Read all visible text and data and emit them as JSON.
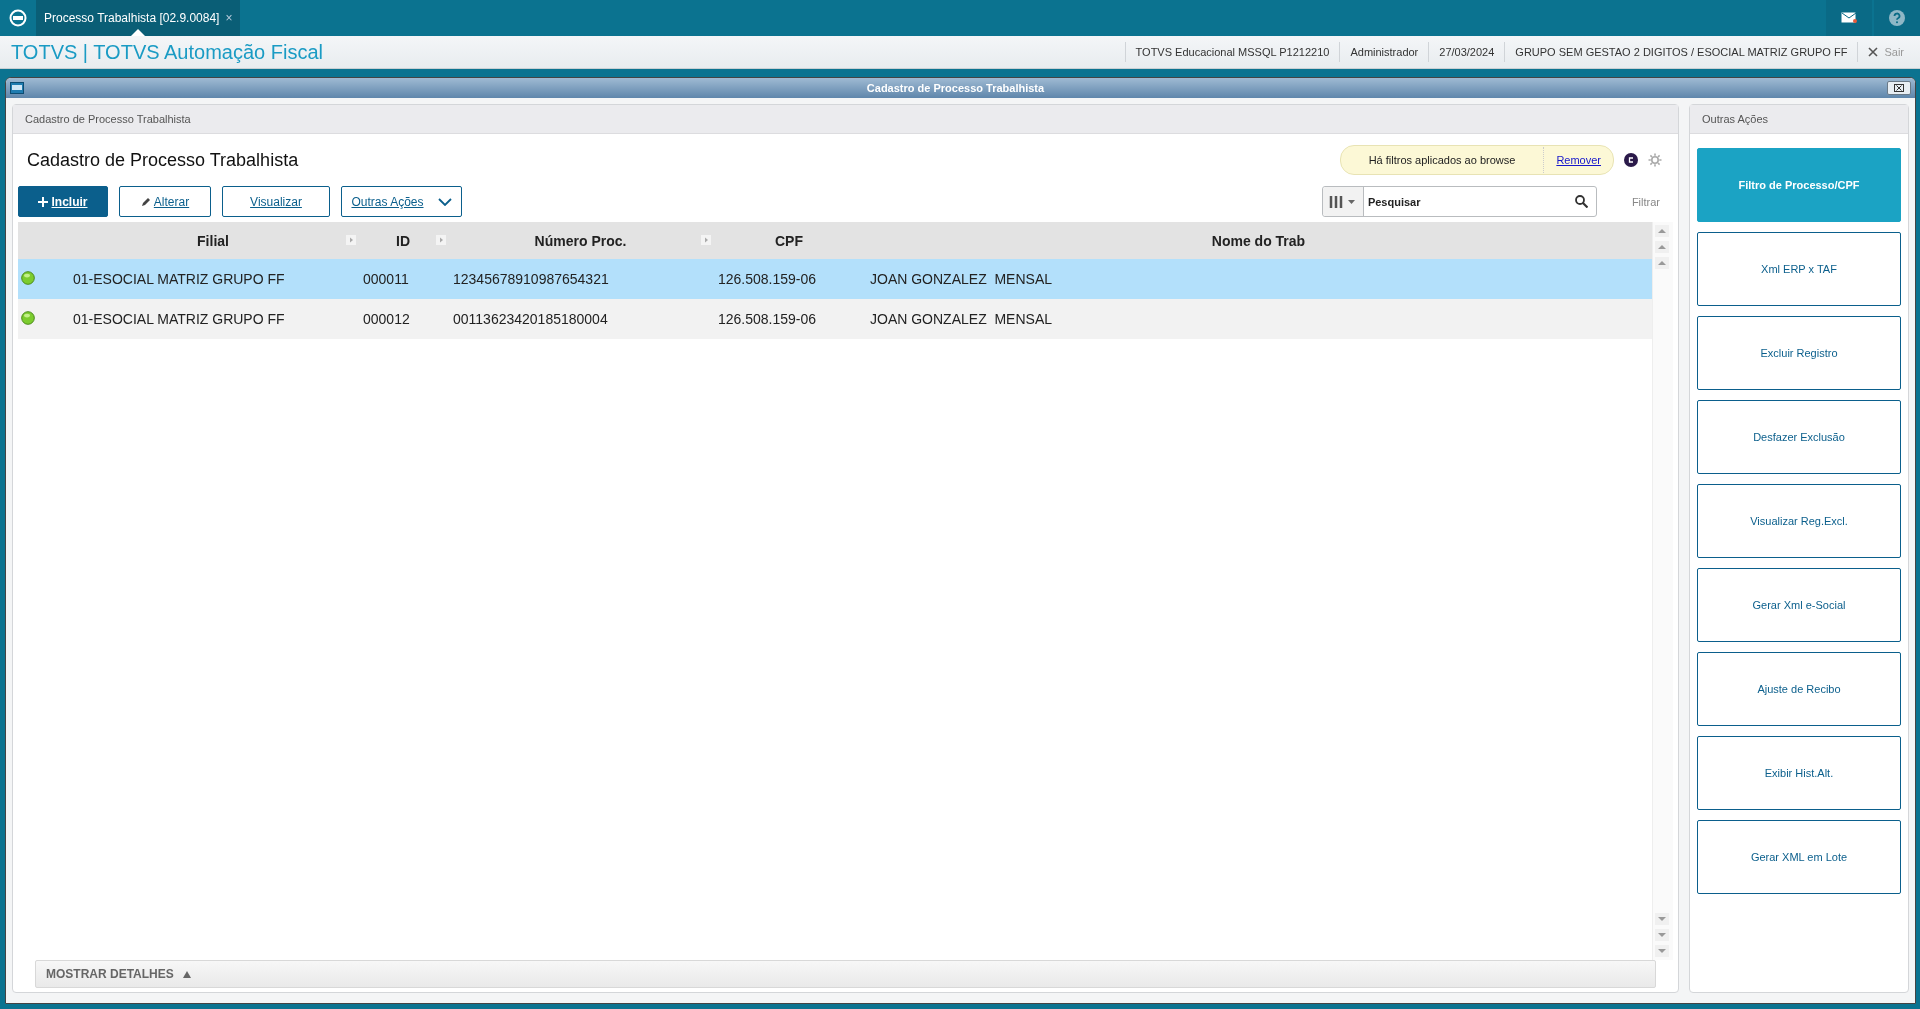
{
  "tab": {
    "label": "Processo Trabalhista [02.9.0084]",
    "close": "×",
    "selected": true
  },
  "header": {
    "title": "TOTVS | TOTVS Automação Fiscal",
    "info": [
      "TOTVS Educacional MSSQL P1212210",
      "Administrador",
      "27/03/2024",
      "GRUPO SEM GESTAO 2 DIGITOS / ESOCIAL MATRIZ GRUPO FF"
    ],
    "exit": "Sair"
  },
  "window": {
    "title": "Cadastro de Processo Trabalhista"
  },
  "browse": {
    "panel_title": "Cadastro de Processo Trabalhista",
    "heading": "Cadastro de Processo Trabalhista",
    "buttons": [
      {
        "label": "Incluir",
        "kind": "primary"
      },
      {
        "label": "Alterar",
        "kind": "edit"
      },
      {
        "label": "Visualizar",
        "kind": "plain"
      },
      {
        "label": "Outras Ações",
        "kind": "dropdown"
      }
    ],
    "filter_notice": {
      "text": "Há filtros aplicados ao browse",
      "link": "Remover"
    },
    "search": {
      "placeholder": "Pesquisar"
    },
    "filter_link": "Filtrar",
    "columns": [
      {
        "label": "Filial",
        "sortable": true
      },
      {
        "label": "ID",
        "sortable": true
      },
      {
        "label": "Número Proc.",
        "sortable": true
      },
      {
        "label": "CPF",
        "sortable": false
      },
      {
        "label": "Nome do Trab",
        "sortable": false
      }
    ],
    "rows": [
      {
        "selected": true,
        "cells": [
          "01-ESOCIAL MATRIZ GRUPO FF",
          "000011",
          "12345678910987654321",
          "126.508.159-06",
          "JOAN GONZALEZ  MENSAL"
        ]
      },
      {
        "selected": false,
        "cells": [
          "01-ESOCIAL MATRIZ GRUPO FF",
          "000012",
          "00113623420185180004",
          "126.508.159-06",
          "JOAN GONZALEZ  MENSAL"
        ]
      }
    ],
    "details": "MOSTRAR DETALHES"
  },
  "actions": {
    "title": "Outras Ações",
    "items": [
      {
        "label": "Filtro de Processo/CPF",
        "selected": true
      },
      {
        "label": "Xml ERP x TAF",
        "selected": false
      },
      {
        "label": "Excluir Registro",
        "selected": false
      },
      {
        "label": "Desfazer Exclusão",
        "selected": false
      },
      {
        "label": "Visualizar Reg.Excl.",
        "selected": false
      },
      {
        "label": "Gerar Xml e-Social",
        "selected": false
      },
      {
        "label": "Ajuste de Recibo",
        "selected": false
      },
      {
        "label": "Exibir Hist.Alt.",
        "selected": false
      },
      {
        "label": "Gerar XML em Lote",
        "selected": false
      }
    ]
  }
}
